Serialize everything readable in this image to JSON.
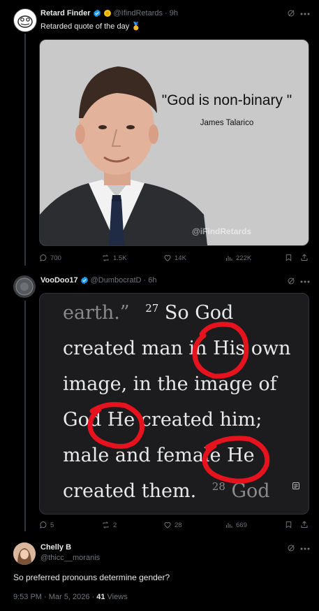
{
  "colors": {
    "accent": "#1d9bf0",
    "bg": "#000000",
    "muted": "#71767b",
    "red": "#e6131f",
    "gold": "#f7c31a"
  },
  "tweet1": {
    "name": "Retard Finder",
    "handle": "@IfindRetards",
    "time": "· 9h",
    "text": "Retarded quote of the day 🥇",
    "quote": "\"God is non-binary \"",
    "attribution": "James Talarico",
    "watermark": "@iFindRetards",
    "stats": {
      "replies": "700",
      "retweets": "1.5K",
      "likes": "14K",
      "views": "222K"
    }
  },
  "tweet2": {
    "name": "VooDoo17",
    "handle": "@DumbocratD",
    "time": "· 6h",
    "bible_lines": [
      "earth.”",
      "27",
      "So God",
      "created man in His own",
      "image, in the image of",
      "God He created him;",
      "male and female He",
      "created them.",
      "28",
      "God"
    ],
    "stats": {
      "replies": "5",
      "retweets": "2",
      "likes": "28",
      "views": "669"
    }
  },
  "tweet3": {
    "name": "Chelly B",
    "handle": "@thicc__moranis",
    "text": "So preferred pronouns determine gender?",
    "timestamp": "9:53 PM · Mar 5, 2026 ·",
    "views_count": "41",
    "views_label": "Views"
  }
}
